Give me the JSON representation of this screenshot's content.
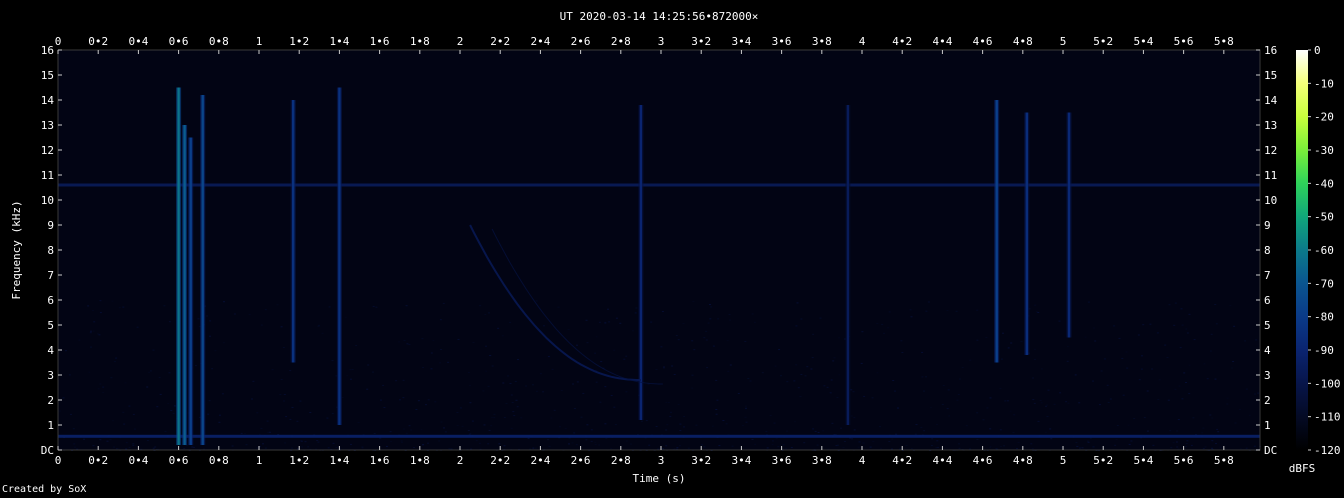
{
  "footer": "Created by SoX",
  "colors": {
    "background": "#000000",
    "plot": "#020414",
    "frame": "#3a3a3a",
    "text": "#ffffff"
  },
  "chart_data": {
    "type": "heatmap",
    "title": "UT 2020-03-14 14:25:56•872000×",
    "xlabel": "Time (s)",
    "ylabel": "Frequency (kHz)",
    "xlim": [
      0,
      5.98
    ],
    "ylim": [
      0,
      16
    ],
    "x_ticks": [
      0,
      0.2,
      0.4,
      0.6,
      0.8,
      1,
      1.2,
      1.4,
      1.6,
      1.8,
      2,
      2.2,
      2.4,
      2.6,
      2.8,
      3,
      3.2,
      3.4,
      3.6,
      3.8,
      4,
      4.2,
      4.4,
      4.6,
      4.8,
      5,
      5.2,
      5.4,
      5.6,
      5.8
    ],
    "x_tick_labels": [
      "0",
      "0•2",
      "0•4",
      "0•6",
      "0•8",
      "1",
      "1•2",
      "1•4",
      "1•6",
      "1•8",
      "2",
      "2•2",
      "2•4",
      "2•6",
      "2•8",
      "3",
      "3•2",
      "3•4",
      "3•6",
      "3•8",
      "4",
      "4•2",
      "4•4",
      "4•6",
      "4•8",
      "5",
      "5•2",
      "5•4",
      "5•6",
      "5•8"
    ],
    "y_ticks": [
      0,
      1,
      2,
      3,
      4,
      5,
      6,
      7,
      8,
      9,
      10,
      11,
      12,
      13,
      14,
      15,
      16
    ],
    "y_tick_labels": [
      "DC",
      "1",
      "2",
      "3",
      "4",
      "5",
      "6",
      "7",
      "8",
      "9",
      "10",
      "11",
      "12",
      "13",
      "14",
      "15",
      "16"
    ],
    "colorbar": {
      "label": "dBFS",
      "range": [
        -120,
        0
      ],
      "ticks": [
        0,
        -10,
        -20,
        -30,
        -40,
        -50,
        -60,
        -70,
        -80,
        -90,
        -100,
        -110,
        -120
      ],
      "tick_labels": [
        "0",
        "-10",
        "-20",
        "-30",
        "-40",
        "-50",
        "-60",
        "-70",
        "-80",
        "-90",
        "-100",
        "-110",
        "-120"
      ],
      "gradient": [
        "#ffffff",
        "#f4ff7a",
        "#c8ff3c",
        "#7af03a",
        "#2ed25a",
        "#10a77a",
        "#0b7a8a",
        "#0a5590",
        "#0a3a88",
        "#0a2470",
        "#07154a",
        "#040a24",
        "#000000"
      ]
    },
    "features": [
      {
        "kind": "band",
        "freq": 10.6,
        "level": -95
      },
      {
        "kind": "band",
        "freq": 0.55,
        "level": -90
      },
      {
        "kind": "burst",
        "t": 0.6,
        "f_min": 0.2,
        "f_max": 14.5,
        "level": -62
      },
      {
        "kind": "burst",
        "t": 0.63,
        "f_min": 0.2,
        "f_max": 13,
        "level": -68
      },
      {
        "kind": "burst",
        "t": 0.66,
        "f_min": 0.2,
        "f_max": 12.5,
        "level": -78
      },
      {
        "kind": "burst",
        "t": 0.72,
        "f_min": 0.2,
        "f_max": 14.2,
        "level": -76
      },
      {
        "kind": "burst",
        "t": 1.17,
        "f_min": 3.5,
        "f_max": 14.0,
        "level": -84
      },
      {
        "kind": "burst",
        "t": 1.4,
        "f_min": 1.0,
        "f_max": 14.5,
        "level": -84
      },
      {
        "kind": "burst",
        "t": 2.9,
        "f_min": 1.2,
        "f_max": 13.8,
        "level": -90
      },
      {
        "kind": "burst",
        "t": 3.93,
        "f_min": 1.0,
        "f_max": 13.8,
        "level": -96
      },
      {
        "kind": "burst",
        "t": 4.67,
        "f_min": 3.5,
        "f_max": 14.0,
        "level": -78
      },
      {
        "kind": "burst",
        "t": 4.82,
        "f_min": 3.8,
        "f_max": 13.5,
        "level": -86
      },
      {
        "kind": "burst",
        "t": 5.03,
        "f_min": 4.5,
        "f_max": 13.5,
        "level": -88
      },
      {
        "kind": "sweep",
        "t_start": 2.05,
        "f_start": 9.0,
        "t_end": 2.9,
        "f_end": 2.8,
        "level": -98
      }
    ]
  }
}
